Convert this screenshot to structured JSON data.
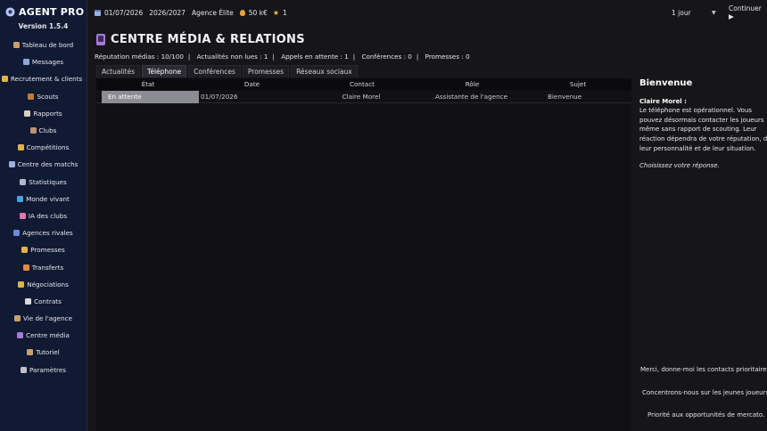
{
  "app": {
    "name": "AGENT PRO",
    "version": "Version 1.5.4"
  },
  "sidebar": {
    "items": [
      {
        "label": "Tableau de bord",
        "icon": "briefcase-icon",
        "color": "#c9a06a"
      },
      {
        "label": "Messages",
        "icon": "mail-icon",
        "color": "#8fa8d8"
      },
      {
        "label": "Recrutement & clients",
        "icon": "handshake-icon",
        "color": "#e3b341"
      },
      {
        "label": "Scouts",
        "icon": "scout-icon",
        "color": "#c57a3a"
      },
      {
        "label": "Rapports",
        "icon": "report-icon",
        "color": "#d8d0c0"
      },
      {
        "label": "Clubs",
        "icon": "stadium-icon",
        "color": "#c09070"
      },
      {
        "label": "Compétitions",
        "icon": "trophy-icon",
        "color": "#e3b341"
      },
      {
        "label": "Centre des matchs",
        "icon": "ball-icon",
        "color": "#9ab0e0"
      },
      {
        "label": "Statistiques",
        "icon": "chart-icon",
        "color": "#b0b8d0"
      },
      {
        "label": "Monde vivant",
        "icon": "globe-icon",
        "color": "#4aa0d8"
      },
      {
        "label": "IA des clubs",
        "icon": "brain-icon",
        "color": "#e07aa8"
      },
      {
        "label": "Agences rivales",
        "icon": "rival-icon",
        "color": "#6a8ad8"
      },
      {
        "label": "Promesses",
        "icon": "promise-icon",
        "color": "#e3b341"
      },
      {
        "label": "Transferts",
        "icon": "transfer-icon",
        "color": "#e08a4a"
      },
      {
        "label": "Négociations",
        "icon": "negotiation-icon",
        "color": "#e3b341"
      },
      {
        "label": "Contrats",
        "icon": "contract-icon",
        "color": "#d8d8e0"
      },
      {
        "label": "Vie de l'agence",
        "icon": "person-icon",
        "color": "#c9a06a"
      },
      {
        "label": "Centre média",
        "icon": "phone-icon",
        "color": "#a57ad8"
      },
      {
        "label": "Tutoriel",
        "icon": "book-icon",
        "color": "#c9a06a"
      },
      {
        "label": "Paramètres",
        "icon": "gear-icon",
        "color": "#c0c0c8"
      }
    ]
  },
  "topbar": {
    "date": "01/07/2026",
    "season": "2026/2027",
    "agency": "Agence Élite",
    "money": "50 k€",
    "stars": "1",
    "speed": "1 jour",
    "continue": "Continuer ▶"
  },
  "page": {
    "title": "CENTRE MÉDIA & RELATIONS",
    "stats": [
      "Réputation médias : 10/100",
      "Actualités non lues : 1",
      "Appels en attente : 1",
      "Conférences : 0",
      "Promesses : 0"
    ],
    "tabs": [
      {
        "label": "Actualités",
        "active": false
      },
      {
        "label": "Téléphone",
        "active": true
      },
      {
        "label": "Conférences",
        "active": false
      },
      {
        "label": "Promesses",
        "active": false
      },
      {
        "label": "Réseaux sociaux",
        "active": false
      }
    ]
  },
  "table": {
    "columns": [
      "État",
      "Date",
      "Contact",
      "Rôle",
      "Sujet"
    ],
    "rows": [
      [
        "En attente",
        "01/07/2026",
        "Claire Morel",
        "Assistante de l'agence",
        "Bienvenue"
      ]
    ]
  },
  "panel": {
    "title": "Bienvenue",
    "speaker": "Claire Morel :",
    "message": "Le téléphone est opérationnel. Vous pouvez désormais contacter les joueurs même sans rapport de scouting. Leur réaction dépendra de votre réputation, de leur personnalité et de leur situation.",
    "prompt": "Choisissez votre réponse.",
    "choices": [
      "Merci, donne-moi les contacts prioritaires.",
      "Concentrons-nous sur les jeunes joueurs.",
      "Priorité aux opportunités de mercato."
    ]
  }
}
